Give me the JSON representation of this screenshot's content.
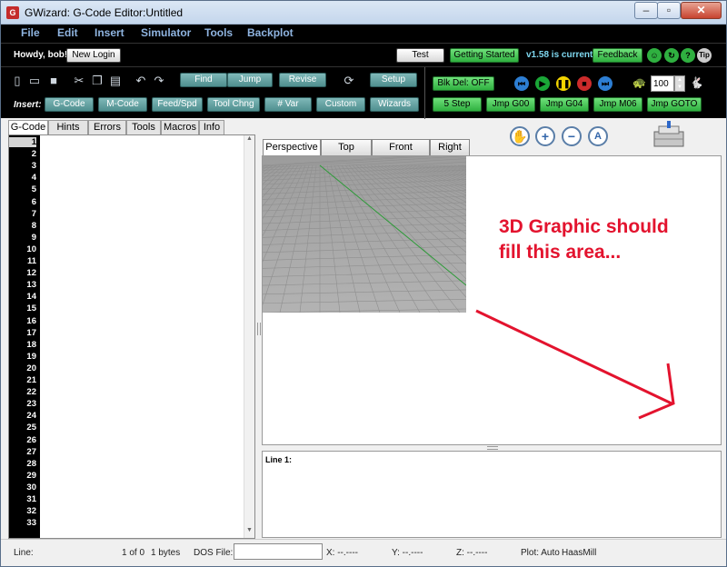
{
  "window": {
    "title": "GWizard: G-Code Editor:Untitled",
    "app_icon": "gw-logo",
    "controls": [
      "minimize",
      "maximize",
      "close"
    ]
  },
  "menu": {
    "items": [
      "File",
      "Edit",
      "Insert",
      "Simulator",
      "Tools",
      "Backplot"
    ]
  },
  "account": {
    "greeting": "Howdy, bob!",
    "login_label": "New Login",
    "test_label": "Test",
    "getting_started_label": "Getting Started",
    "version": "v1.58 is current",
    "feedback_label": "Feedback",
    "tip_label": "Tip"
  },
  "toolbar": {
    "find_label": "Find",
    "jump_label": "Jump",
    "revise_label": "Revise",
    "setup_label": "Setup",
    "insert_label": "Insert:",
    "insert_buttons": [
      "G-Code",
      "M-Code",
      "Feed/Spd",
      "Tool Chng",
      "# Var",
      "Custom",
      "Wizards"
    ]
  },
  "sim": {
    "blkdel_label": "Blk Del: OFF",
    "speed_value": "100",
    "buttons": [
      "5 Step",
      "Jmp G00",
      "Jmp G04",
      "Jmp M06",
      "Jmp GOTO"
    ]
  },
  "colors": {
    "accent_green": "#2fb040",
    "teal": "#5a9a9a",
    "annotation_red": "#e3132e",
    "play_green": "#1aa637",
    "pause_yellow": "#f2d400",
    "stop_red": "#cc2b2b",
    "nav_blue": "#2d7ed3"
  },
  "left_tabs": [
    "G-Code",
    "Hints",
    "Errors",
    "Tools",
    "Macros",
    "Info"
  ],
  "line_numbers": [
    "1",
    "2",
    "3",
    "4",
    "5",
    "6",
    "7",
    "8",
    "9",
    "10",
    "11",
    "12",
    "13",
    "14",
    "15",
    "16",
    "17",
    "18",
    "19",
    "20",
    "21",
    "22",
    "23",
    "24",
    "25",
    "26",
    "27",
    "28",
    "29",
    "30",
    "31",
    "32",
    "33"
  ],
  "view_tabs": [
    "Perspective",
    "Top",
    "Front",
    "Right"
  ],
  "annotation": {
    "line1": "3D Graphic should",
    "line2": "fill this area..."
  },
  "line_panel": {
    "label": "Line 1:"
  },
  "status": {
    "line_label": "Line:",
    "position": "1 of 0",
    "bytes": "1 bytes",
    "dos_label": "DOS File:",
    "x": "X:  --.----",
    "y": "Y:  --.----",
    "z": "Z:  --.----",
    "plot": "Plot: Auto",
    "machine": "HaasMill"
  }
}
